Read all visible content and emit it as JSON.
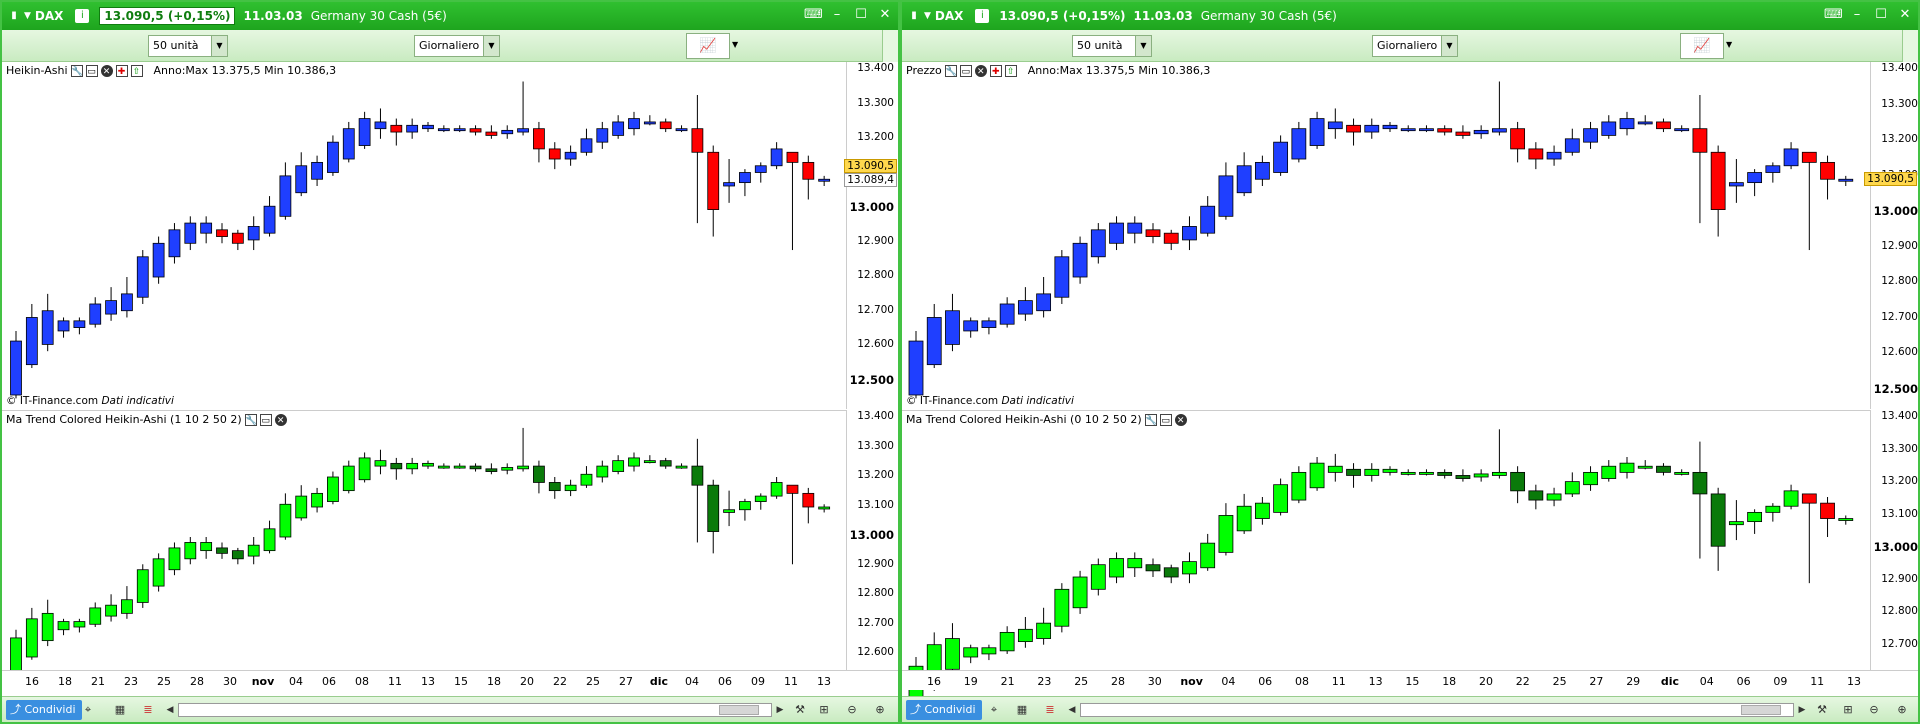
{
  "colors": {
    "bull_blue": "#1f3fff",
    "bear_red": "#ff0000",
    "trend_light_green": "#00ff00",
    "trend_dark_green": "#0a7a0a",
    "trend_red": "#ff0000",
    "titlebar_green": "#1ea51e",
    "price_highlight": "#ffd84d"
  },
  "windows": [
    {
      "id": "left",
      "title": {
        "symbol": "DAX",
        "price": "13.090,5 (+0,15%)",
        "time": "11.03.03",
        "description": "Germany 30 Cash (5€)"
      },
      "toolbar": {
        "units_label": "50 unità",
        "period_label": "Giornaliero"
      },
      "price_pane": {
        "label": "Heikin-Ashi",
        "range_text": "Anno:Max 13.375,5 Min 10.386,3",
        "copyright": "© IT-Finance.com",
        "copyright_note": "Dati indicativi",
        "ticks": [
          "13.400",
          "13.300",
          "13.200",
          "13.100",
          "13.000",
          "12.900",
          "12.800",
          "12.700",
          "12.600",
          "12.500"
        ],
        "bold_ticks": [
          "13.000",
          "12.500"
        ],
        "price_tag": "13.090,5",
        "price_tag2": "13.089,4"
      },
      "indicator_pane": {
        "label": "Ma Trend Colored  Heikin-Ashi (1 10 2 50 2)",
        "ticks": [
          "13.400",
          "13.300",
          "13.200",
          "13.100",
          "13.000",
          "12.900",
          "12.800",
          "12.700",
          "12.600"
        ],
        "bold_ticks": [
          "13.000"
        ]
      },
      "x_labels": [
        "16",
        "18",
        "21",
        "23",
        "25",
        "28",
        "30",
        "nov",
        "04",
        "06",
        "08",
        "11",
        "13",
        "15",
        "18",
        "20",
        "22",
        "25",
        "27",
        "dic",
        "04",
        "06",
        "09",
        "11",
        "13"
      ],
      "bold_x_labels": [
        "nov",
        "dic"
      ],
      "share_label": "Condividi"
    },
    {
      "id": "right",
      "title": {
        "symbol": "DAX",
        "price": "13.090,5 (+0,15%)",
        "time": "11.03.03",
        "description": "Germany 30 Cash (5€)"
      },
      "toolbar": {
        "units_label": "50 unità",
        "period_label": "Giornaliero"
      },
      "price_pane": {
        "label": "Prezzo",
        "range_text": "Anno:Max 13.375,5 Min 10.386,3",
        "copyright": "© IT-Finance.com",
        "copyright_note": "Dati indicativi",
        "ticks": [
          "13.400",
          "13.300",
          "13.200",
          "13.100",
          "13.000",
          "12.900",
          "12.800",
          "12.700",
          "12.600",
          "12.500"
        ],
        "bold_ticks": [
          "13.000",
          "12.500"
        ],
        "price_tag": "13.090,5"
      },
      "indicator_pane": {
        "label": "Ma Trend Colored  Heikin-Ashi (0 10 2 50 2)",
        "ticks": [
          "13.400",
          "13.300",
          "13.200",
          "13.100",
          "13.000",
          "12.900",
          "12.800",
          "12.700"
        ],
        "bold_ticks": [
          "13.000"
        ]
      },
      "x_labels": [
        "16",
        "19",
        "21",
        "23",
        "25",
        "28",
        "30",
        "nov",
        "04",
        "06",
        "08",
        "11",
        "13",
        "15",
        "18",
        "20",
        "22",
        "25",
        "27",
        "29",
        "dic",
        "04",
        "06",
        "09",
        "11",
        "13"
      ],
      "bold_x_labels": [
        "nov",
        "dic"
      ],
      "share_label": "Condividi"
    }
  ],
  "chart_data": [
    {
      "type": "candlestick",
      "title": "Heikin-Ashi",
      "ylim": [
        12450,
        13420
      ],
      "candles": [
        [
          12450,
          12610,
          12440,
          12640,
          "b"
        ],
        [
          12540,
          12680,
          12530,
          12720,
          "b"
        ],
        [
          12600,
          12700,
          12580,
          12750,
          "b"
        ],
        [
          12640,
          12670,
          12620,
          12680,
          "b"
        ],
        [
          12650,
          12670,
          12630,
          12680,
          "b"
        ],
        [
          12660,
          12720,
          12650,
          12740,
          "b"
        ],
        [
          12690,
          12730,
          12670,
          12770,
          "b"
        ],
        [
          12700,
          12750,
          12680,
          12800,
          "b"
        ],
        [
          12740,
          12860,
          12720,
          12880,
          "b"
        ],
        [
          12800,
          12900,
          12780,
          12920,
          "b"
        ],
        [
          12860,
          12940,
          12840,
          12960,
          "b"
        ],
        [
          12900,
          12960,
          12880,
          12980,
          "b"
        ],
        [
          12930,
          12960,
          12900,
          12980,
          "b"
        ],
        [
          12940,
          12920,
          12900,
          12960,
          "r"
        ],
        [
          12930,
          12900,
          12880,
          12940,
          "r"
        ],
        [
          12910,
          12950,
          12880,
          12980,
          "b"
        ],
        [
          12930,
          13010,
          12920,
          13040,
          "b"
        ],
        [
          12980,
          13100,
          12970,
          13140,
          "b"
        ],
        [
          13050,
          13130,
          13040,
          13170,
          "b"
        ],
        [
          13090,
          13140,
          13070,
          13160,
          "b"
        ],
        [
          13110,
          13200,
          13100,
          13220,
          "b"
        ],
        [
          13150,
          13240,
          13140,
          13260,
          "b"
        ],
        [
          13190,
          13270,
          13180,
          13290,
          "b"
        ],
        [
          13240,
          13260,
          13210,
          13300,
          "b"
        ],
        [
          13250,
          13230,
          13190,
          13270,
          "r"
        ],
        [
          13230,
          13250,
          13210,
          13270,
          "b"
        ],
        [
          13240,
          13250,
          13230,
          13260,
          "b"
        ],
        [
          13240,
          13240,
          13230,
          13250,
          "b"
        ],
        [
          13240,
          13240,
          13230,
          13250,
          "b"
        ],
        [
          13240,
          13230,
          13220,
          13250,
          "r"
        ],
        [
          13230,
          13220,
          13210,
          13250,
          "r"
        ],
        [
          13225,
          13235,
          13210,
          13250,
          "b"
        ],
        [
          13230,
          13240,
          13220,
          13380,
          "b"
        ],
        [
          13240,
          13180,
          13140,
          13260,
          "r"
        ],
        [
          13180,
          13150,
          13120,
          13200,
          "r"
        ],
        [
          13150,
          13170,
          13130,
          13190,
          "b"
        ],
        [
          13170,
          13210,
          13160,
          13240,
          "b"
        ],
        [
          13200,
          13240,
          13180,
          13260,
          "b"
        ],
        [
          13220,
          13260,
          13210,
          13280,
          "b"
        ],
        [
          13240,
          13270,
          13220,
          13290,
          "b"
        ],
        [
          13260,
          13260,
          13250,
          13280,
          "b"
        ],
        [
          13260,
          13240,
          13230,
          13270,
          "r"
        ],
        [
          13240,
          13240,
          13230,
          13250,
          "b"
        ],
        [
          13240,
          13170,
          12960,
          13340,
          "r"
        ],
        [
          13170,
          13000,
          12920,
          13190,
          "r"
        ],
        [
          13070,
          13080,
          13020,
          13150,
          "b"
        ],
        [
          13080,
          13110,
          13040,
          13120,
          "b"
        ],
        [
          13110,
          13130,
          13080,
          13140,
          "b"
        ],
        [
          13130,
          13180,
          13120,
          13200,
          "b"
        ],
        [
          13170,
          13140,
          12880,
          13170,
          "r"
        ],
        [
          13140,
          13090,
          13030,
          13160,
          "r"
        ],
        [
          13090,
          13089,
          13070,
          13100,
          "b"
        ]
      ]
    }
  ]
}
